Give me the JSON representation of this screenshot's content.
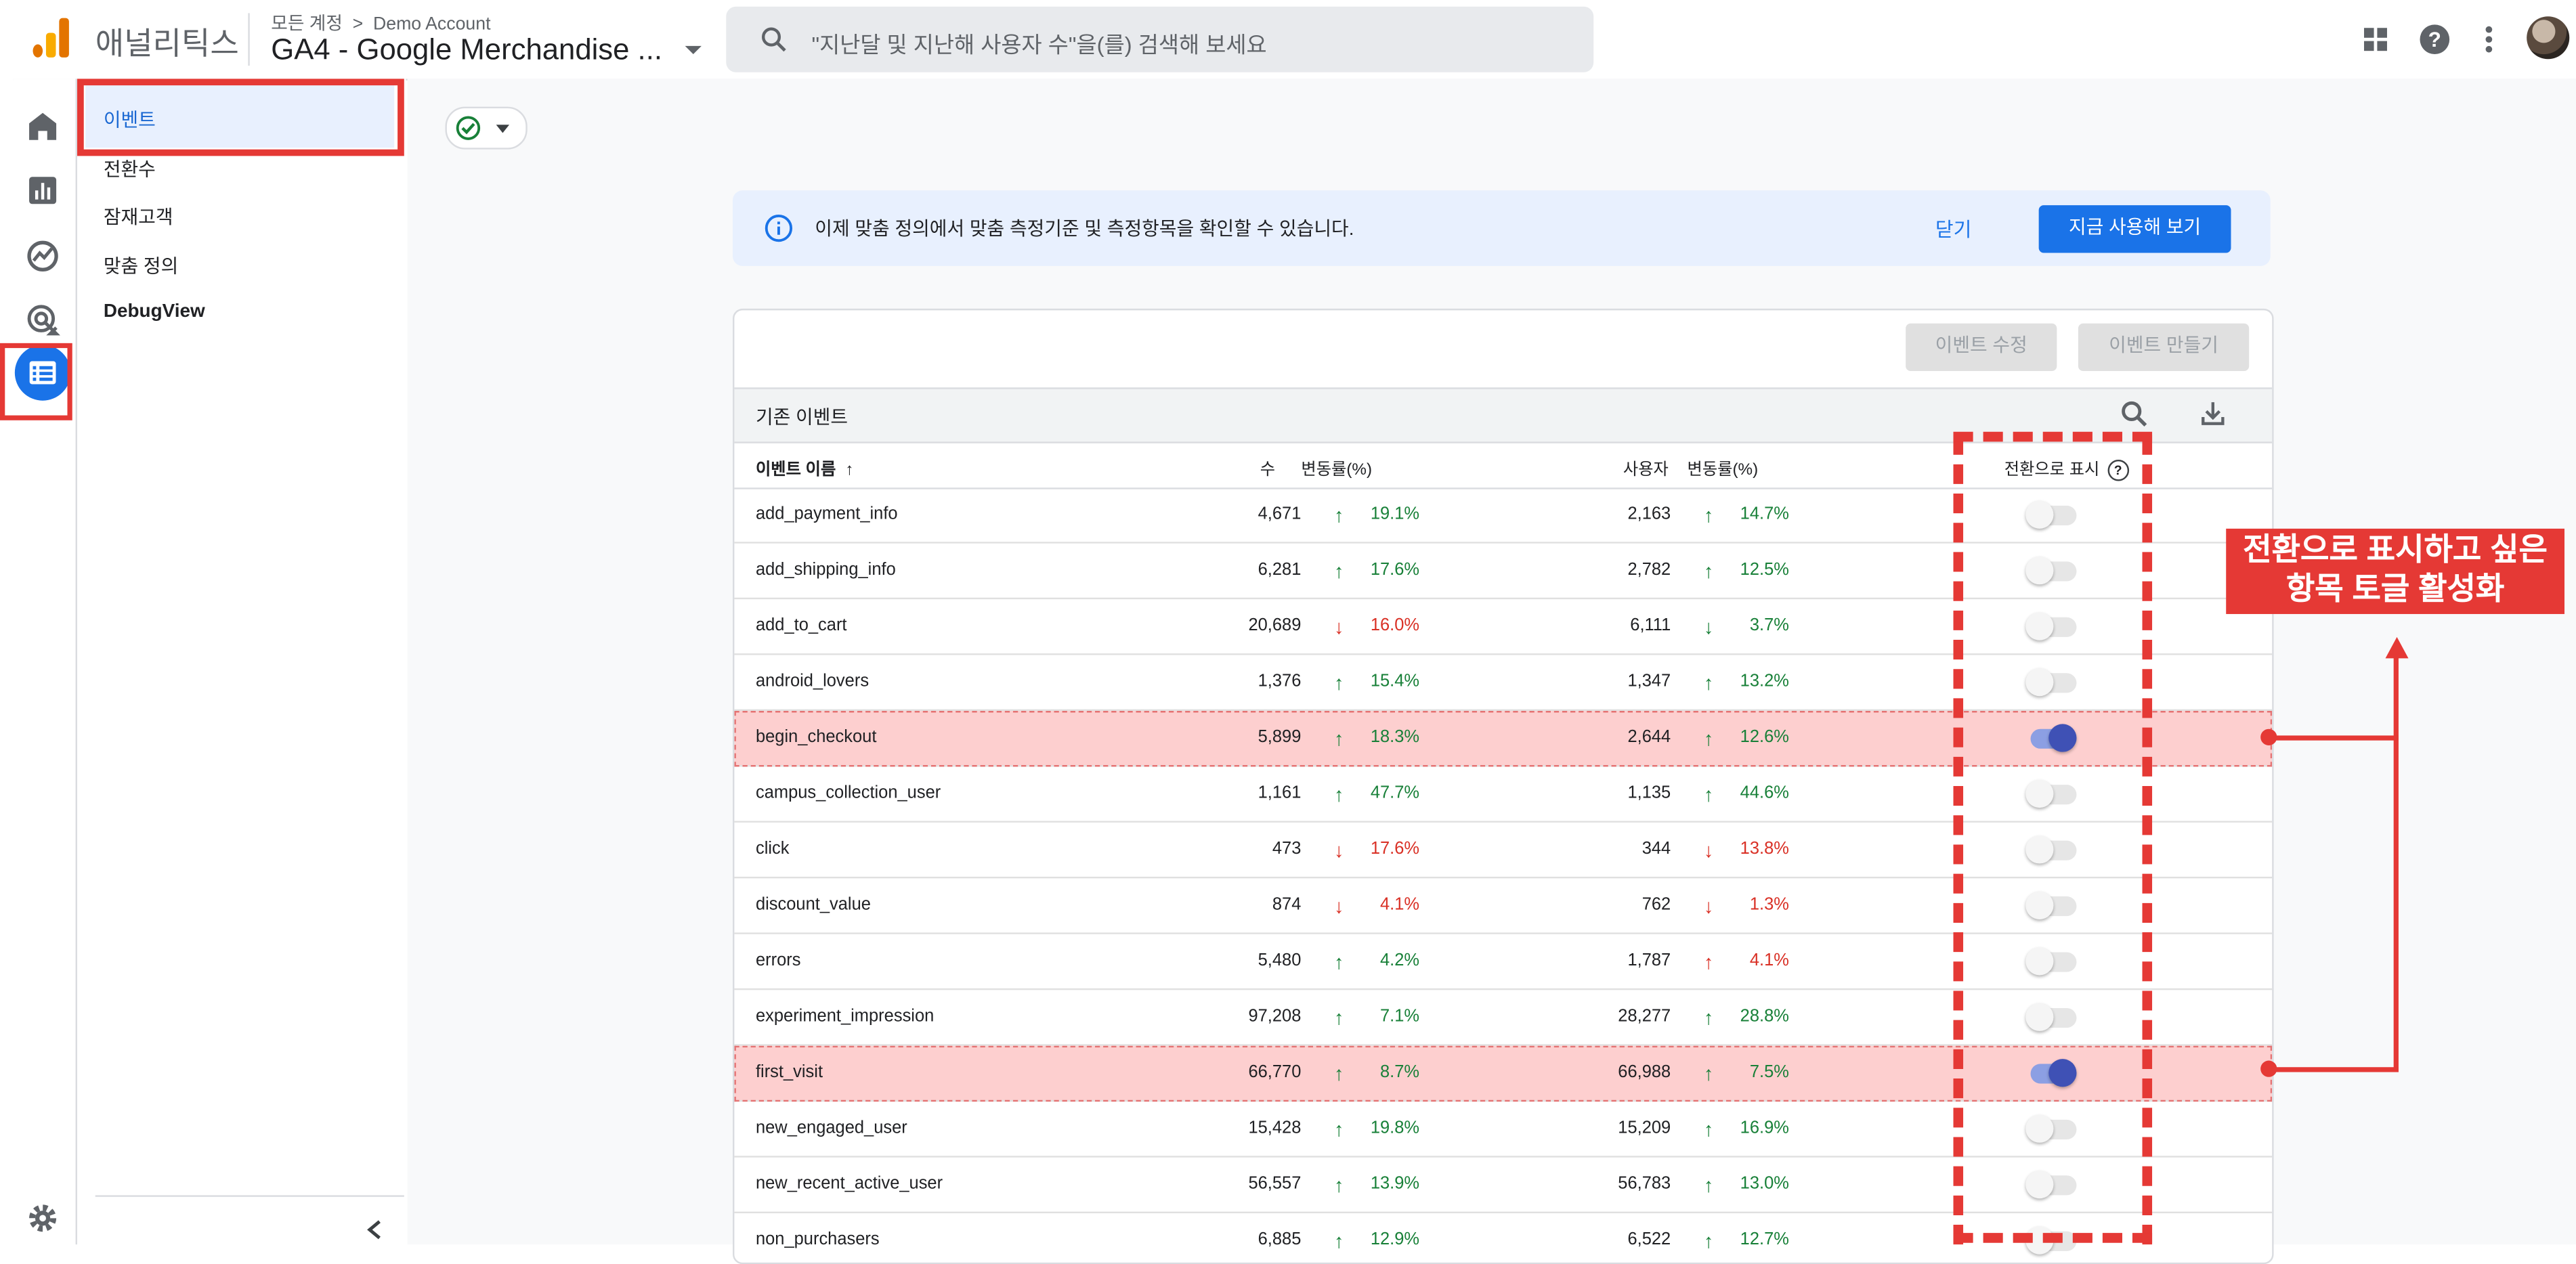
{
  "header": {
    "app_name": "애널리틱스",
    "breadcrumb_root": "모든 계정",
    "breadcrumb_sep": ">",
    "breadcrumb_account": "Demo Account",
    "property_name": "GA4 - Google Merchandise ...",
    "search_placeholder": "\"지난달 및 지난해 사용자 수\"을(를) 검색해 보세요",
    "icons": [
      "apps-icon",
      "help-icon",
      "more-vert-icon"
    ]
  },
  "rail": {
    "icons": [
      "home-icon",
      "reports-icon",
      "explore-icon",
      "advertising-icon",
      "configure-icon"
    ],
    "settings_icon": "gear-icon"
  },
  "subnav": {
    "items": [
      {
        "label": "이벤트",
        "active": true
      },
      {
        "label": "전환수"
      },
      {
        "label": "잠재고객"
      },
      {
        "label": "맞춤 정의"
      },
      {
        "label": "DebugView"
      }
    ]
  },
  "banner": {
    "text": "이제 맞춤 정의에서 맞춤 측정기준 및 측정항목을 확인할 수 있습니다.",
    "close_label": "닫기",
    "action_label": "지금 사용해 보기"
  },
  "card": {
    "edit_button": "이벤트 수정",
    "create_button": "이벤트 만들기",
    "table_title": "기존 이벤트"
  },
  "columns": {
    "name": "이벤트 이름",
    "name_sort": "↑",
    "count": "수",
    "count_change": "변동률(%)",
    "users": "사용자",
    "users_change": "변동률(%)",
    "conversion": "전환으로 표시",
    "conversion_help": "?"
  },
  "rows": [
    {
      "name": "add_payment_info",
      "count": "4,671",
      "count_dir": "up",
      "count_pct": "19.1%",
      "users": "2,163",
      "users_dir": "up",
      "users_pct": "14.7%",
      "conversion": false
    },
    {
      "name": "add_shipping_info",
      "count": "6,281",
      "count_dir": "up",
      "count_pct": "17.6%",
      "users": "2,782",
      "users_dir": "up",
      "users_pct": "12.5%",
      "conversion": false
    },
    {
      "name": "add_to_cart",
      "count": "20,689",
      "count_dir": "down",
      "count_pct": "16.0%",
      "users": "6,111",
      "users_dir": "down_green",
      "users_pct": "3.7%",
      "conversion": false
    },
    {
      "name": "android_lovers",
      "count": "1,376",
      "count_dir": "up",
      "count_pct": "15.4%",
      "users": "1,347",
      "users_dir": "up",
      "users_pct": "13.2%",
      "conversion": false
    },
    {
      "name": "begin_checkout",
      "count": "5,899",
      "count_dir": "up",
      "count_pct": "18.3%",
      "users": "2,644",
      "users_dir": "up",
      "users_pct": "12.6%",
      "conversion": true
    },
    {
      "name": "campus_collection_user",
      "count": "1,161",
      "count_dir": "up",
      "count_pct": "47.7%",
      "users": "1,135",
      "users_dir": "up",
      "users_pct": "44.6%",
      "conversion": false
    },
    {
      "name": "click",
      "count": "473",
      "count_dir": "down",
      "count_pct": "17.6%",
      "users": "344",
      "users_dir": "down",
      "users_pct": "13.8%",
      "conversion": false
    },
    {
      "name": "discount_value",
      "count": "874",
      "count_dir": "down",
      "count_pct": "4.1%",
      "users": "762",
      "users_dir": "down",
      "users_pct": "1.3%",
      "conversion": false
    },
    {
      "name": "errors",
      "count": "5,480",
      "count_dir": "up",
      "count_pct": "4.2%",
      "users": "1,787",
      "users_dir": "up_red",
      "users_pct": "4.1%",
      "conversion": false
    },
    {
      "name": "experiment_impression",
      "count": "97,208",
      "count_dir": "up",
      "count_pct": "7.1%",
      "users": "28,277",
      "users_dir": "up",
      "users_pct": "28.8%",
      "conversion": false
    },
    {
      "name": "first_visit",
      "count": "66,770",
      "count_dir": "up",
      "count_pct": "8.7%",
      "users": "66,988",
      "users_dir": "up",
      "users_pct": "7.5%",
      "conversion": true
    },
    {
      "name": "new_engaged_user",
      "count": "15,428",
      "count_dir": "up",
      "count_pct": "19.8%",
      "users": "15,209",
      "users_dir": "up",
      "users_pct": "16.9%",
      "conversion": false
    },
    {
      "name": "new_recent_active_user",
      "count": "56,557",
      "count_dir": "up",
      "count_pct": "13.9%",
      "users": "56,783",
      "users_dir": "up",
      "users_pct": "13.0%",
      "conversion": false
    },
    {
      "name": "non_purchasers",
      "count": "6,885",
      "count_dir": "up",
      "count_pct": "12.9%",
      "users": "6,522",
      "users_dir": "up",
      "users_pct": "12.7%",
      "conversion": false
    }
  ],
  "annotation": {
    "line1": "전환으로 표시하고 싶은",
    "line2": "항목 토글 활성화"
  },
  "colors": {
    "brand_blue": "#1a73e8",
    "highlight_red": "#e53935",
    "up_green": "#188038",
    "down_red": "#d93025",
    "row_highlight": "#fdcfcf",
    "toggle_on": "#3f51b5"
  }
}
